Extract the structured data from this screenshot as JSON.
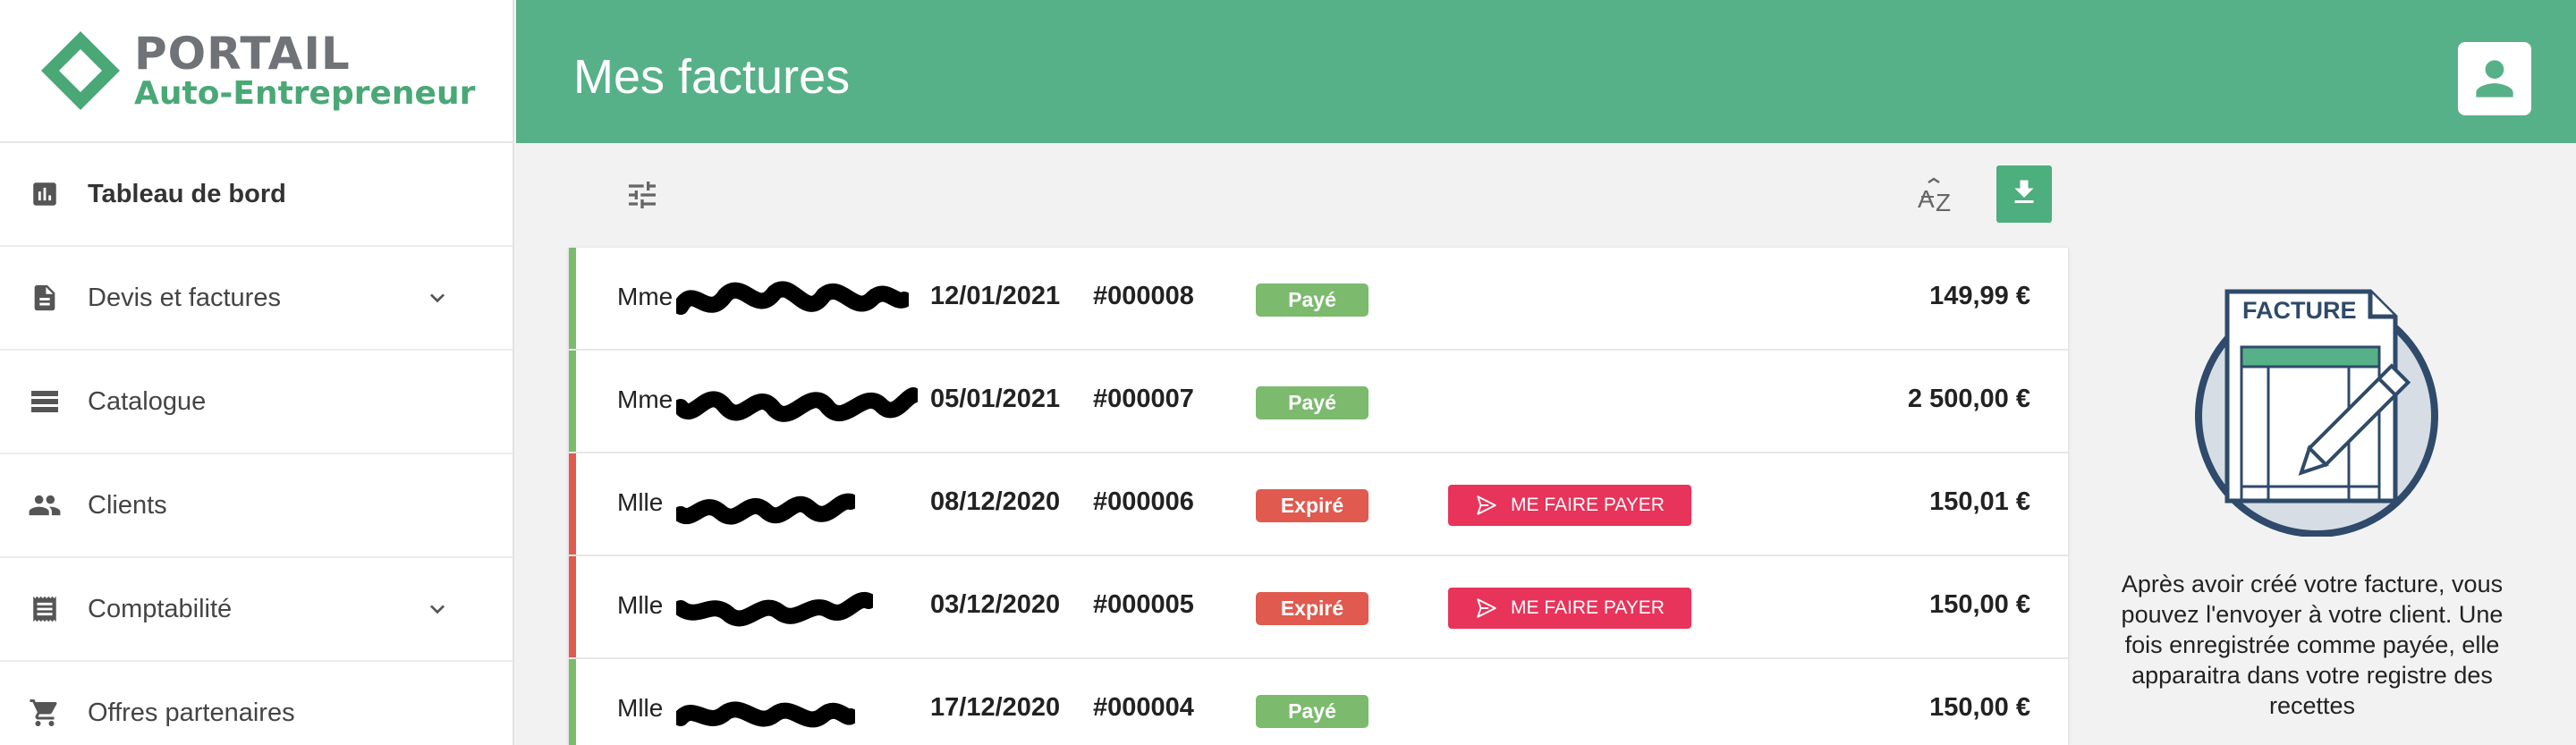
{
  "logo": {
    "title": "PORTAIL",
    "subtitle": "Auto-Entrepreneur"
  },
  "sidebar": {
    "items": [
      {
        "label": "Tableau de bord",
        "icon": "bar-chart-icon",
        "active": true,
        "expandable": false
      },
      {
        "label": "Devis et factures",
        "icon": "document-icon",
        "active": false,
        "expandable": true
      },
      {
        "label": "Catalogue",
        "icon": "list-icon",
        "active": false,
        "expandable": false
      },
      {
        "label": "Clients",
        "icon": "people-icon",
        "active": false,
        "expandable": false
      },
      {
        "label": "Comptabilité",
        "icon": "receipt-icon",
        "active": false,
        "expandable": true
      },
      {
        "label": "Offres partenaires",
        "icon": "cart-icon",
        "active": false,
        "expandable": false
      }
    ]
  },
  "header": {
    "title": "Mes factures",
    "avatar_icon": "account-icon"
  },
  "toolbar": {
    "filter_icon": "tune-icon",
    "sort_icon": "sort-az-icon",
    "download_icon": "download-icon"
  },
  "invoices": [
    {
      "client": "Mme",
      "date": "12/01/2021",
      "number": "#000008",
      "status": "Payé",
      "status_color": "#7cba6e",
      "action": "",
      "amount": "149,99 €"
    },
    {
      "client": "Mme",
      "date": "05/01/2021",
      "number": "#000007",
      "status": "Payé",
      "status_color": "#7cba6e",
      "action": "",
      "amount": "2 500,00 €"
    },
    {
      "client": "Mlle",
      "date": "08/12/2020",
      "number": "#000006",
      "status": "Expiré",
      "status_color": "#e05a4f",
      "action": "ME FAIRE PAYER",
      "amount": "150,01 €"
    },
    {
      "client": "Mlle",
      "date": "03/12/2020",
      "number": "#000005",
      "status": "Expiré",
      "status_color": "#e05a4f",
      "action": "ME FAIRE PAYER",
      "amount": "150,00 €"
    },
    {
      "client": "Mlle",
      "date": "17/12/2020",
      "number": "#000004",
      "status": "Payé",
      "status_color": "#7cba6e",
      "action": "",
      "amount": "150,00 €"
    }
  ],
  "illustration": {
    "label": "FACTURE"
  },
  "help": {
    "text": "Après avoir créé votre facture, vous pouvez l'envoyer à votre client. Une fois enregistrée comme payée, elle apparaitra dans votre registre des recettes"
  },
  "colors": {
    "brand_green": "#57b188",
    "paid_accent": "#7cba6e",
    "expired_accent": "#e05a4f",
    "action_red": "#e8335a"
  }
}
